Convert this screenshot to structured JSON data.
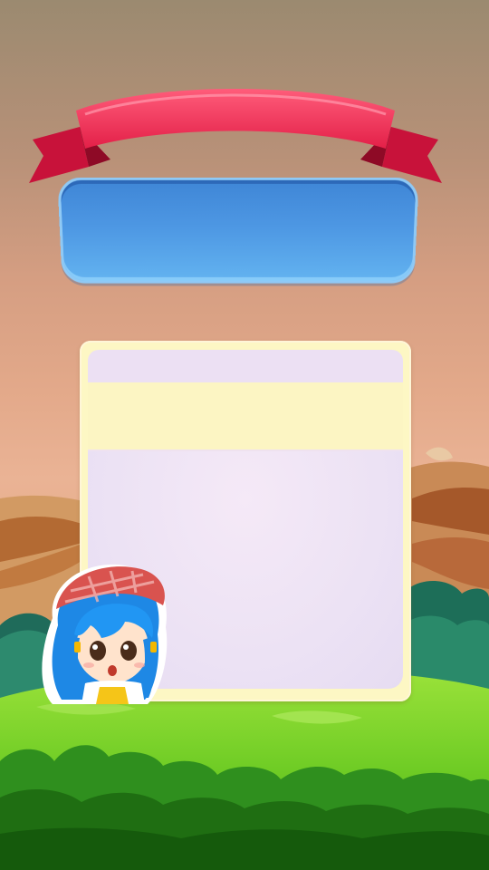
{
  "screen": {
    "title_banner": {
      "ribbon_color": "#f0365a",
      "panel_color": "#4d97e3",
      "title_text": ""
    },
    "info_card": {
      "header_text": "",
      "band_text": "",
      "body_text": "",
      "colors": {
        "frame": "#fdf7c4",
        "header": "#ece0f3",
        "body": "#ece2f4"
      }
    },
    "mascot": {
      "icon": "girl-character-icon"
    },
    "background": {
      "sky": "#e3a98a",
      "grass": "#7ed321",
      "bushes": "#2e7d1e"
    }
  }
}
